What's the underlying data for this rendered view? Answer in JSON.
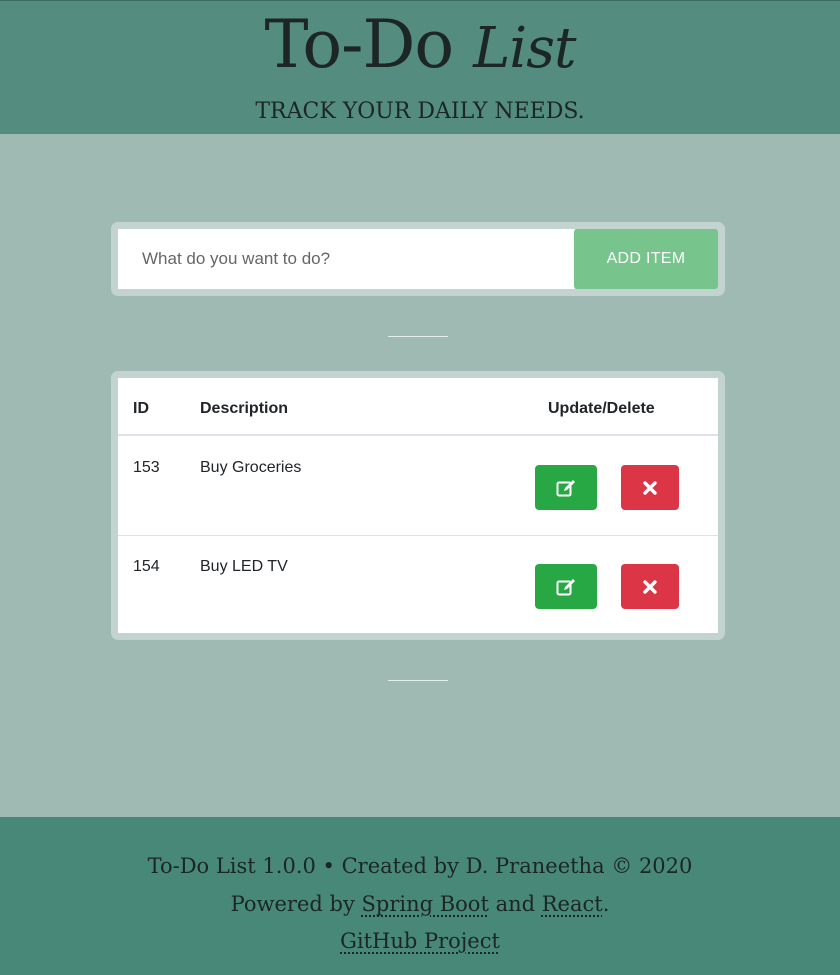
{
  "header": {
    "title_main": "To-Do",
    "title_italic": "List",
    "subtitle": "TRACK YOUR DAILY NEEDS."
  },
  "form": {
    "placeholder": "What do you want to do?",
    "add_label": "ADD ITEM"
  },
  "table": {
    "columns": [
      "ID",
      "Description",
      "Update/Delete"
    ],
    "rows": [
      {
        "id": "153",
        "description": "Buy Groceries"
      },
      {
        "id": "154",
        "description": "Buy LED TV"
      }
    ]
  },
  "footer": {
    "line1": "To-Do List 1.0.0 • Created by D. Praneetha © 2020",
    "powered_prefix": "Powered by ",
    "spring_link": "Spring Boot",
    "and_text": " and ",
    "react_link": "React",
    "period": ".",
    "github_link": "GitHub Project"
  },
  "colors": {
    "header_bg": "#548c80",
    "page_bg": "#9fb9b3",
    "add_button": "#77c48c",
    "edit_button": "#28a745",
    "delete_button": "#dc3545",
    "footer_bg": "#478878"
  },
  "icons": {
    "edit": "pencil-square-icon",
    "delete": "x-mark-icon"
  }
}
